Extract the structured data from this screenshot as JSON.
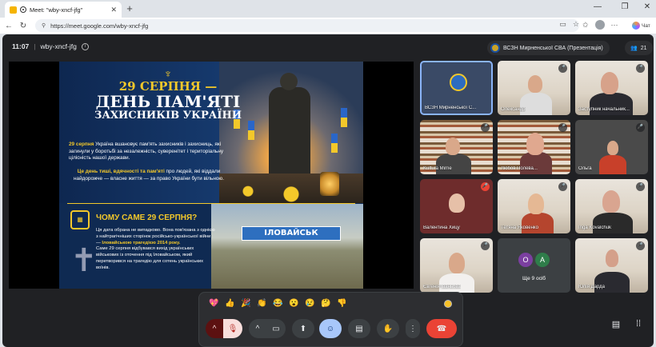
{
  "browser": {
    "tab_title": "Meet: \"wby-xncf-jfg\"",
    "url": "https://meet.google.com/wby-xncf-jfg",
    "chat_label": "Чат"
  },
  "meeting": {
    "time": "11:07",
    "code": "wby-xncf-jfg",
    "presenter": "ВСЗН Мирненської СВА (Презентація)",
    "participants_count": "21"
  },
  "slide": {
    "title_line1": "29 СЕРПНЯ —",
    "title_line2": "ДЕНЬ ПАМ'ЯТІ",
    "title_line3": "ЗАХИСНИКІВ УКРАЇНИ",
    "para1_bold": "29 серпня",
    "para1_text": " Україна вшановує пам'ять захисників і захисниць, які загинули у боротьбі за незалежність, суверенітет і територіальну цілісність нашої держави.",
    "para2_bold": "Це день тиші, вдячності та пам'яті",
    "para2_text": " про людей, які віддали найдорожче — власне життя — за право України бути вільною.",
    "section_title": "ЧОМУ САМЕ 29 СЕРПНЯ?",
    "para3_a": "Ця дата обрана не випадково. Вона пов'язана з однією з найтрагічніших сторінок російсько-української війни —",
    "para3_bold": "Іловайською трагедією 2014 року.",
    "para3_b": "Саме 29 серпня відбувався вихід українських військових із оточення під Іловайськом, який перетворився на трагедію для сотень українських воїнів.",
    "sign_text": "ІЛОВАЙСЬК"
  },
  "participants": [
    {
      "name": "ВСЗН Мирненської С..."
    },
    {
      "name": "Олександр"
    },
    {
      "name": "Заступник начальник..."
    },
    {
      "name": "Kultura Mirne"
    },
    {
      "name": "Любов Полева..."
    },
    {
      "name": "Ольга"
    },
    {
      "name": "Валентина Хицу"
    },
    {
      "name": "Тетяна Яковенко"
    },
    {
      "name": "Inga Kovalchuk"
    },
    {
      "name": "Євгенія Іваньова"
    },
    {
      "name": "Ще 9 осіб"
    },
    {
      "name": "Юлія Дарда"
    }
  ],
  "more_avatars": [
    "O",
    "A"
  ],
  "reactions": [
    "💖",
    "👍",
    "🎉",
    "👏",
    "😂",
    "😮",
    "😢",
    "🤔",
    "👎"
  ],
  "colors": {
    "accent": "#f3c82a",
    "end_call": "#ea4335",
    "active_border": "#8ab4f8"
  }
}
